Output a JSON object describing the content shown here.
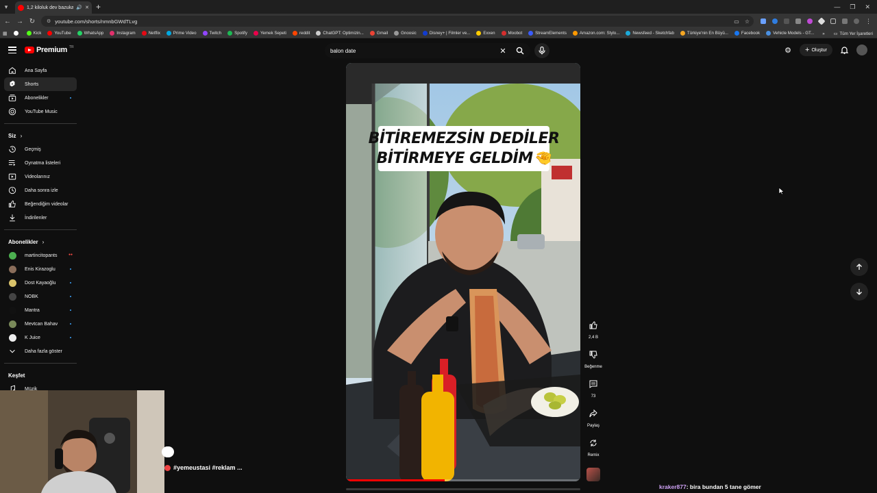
{
  "browser": {
    "tab_title": "1,2 kiloluk dev bazuka 🤡 #",
    "url": "youtube.com/shorts/nmnbGWdTLvg",
    "bookmarks": [
      {
        "label": "",
        "color": "#ffffff"
      },
      {
        "label": "Kick",
        "color": "#53fc18"
      },
      {
        "label": "YouTube",
        "color": "#ff0000"
      },
      {
        "label": "WhatsApp",
        "color": "#25d366"
      },
      {
        "label": "Instagram",
        "color": "#e1306c"
      },
      {
        "label": "Netflix",
        "color": "#e50914"
      },
      {
        "label": "Prime Video",
        "color": "#00a8e1"
      },
      {
        "label": "Twitch",
        "color": "#9146ff"
      },
      {
        "label": "Spotify",
        "color": "#1db954"
      },
      {
        "label": "Yemek Sepeti",
        "color": "#ea004b"
      },
      {
        "label": "reddit",
        "color": "#ff4500"
      },
      {
        "label": "ChatGPT: Optimizin...",
        "color": "#cccccc"
      },
      {
        "label": "Gmail",
        "color": "#ea4335"
      },
      {
        "label": "Gnoosic",
        "color": "#999999"
      },
      {
        "label": "Disney+ | Filmler ve...",
        "color": "#113ccf"
      },
      {
        "label": "Exxen",
        "color": "#ffcc00"
      },
      {
        "label": "Moobot",
        "color": "#d62e2e"
      },
      {
        "label": "StreamElements",
        "color": "#3a5cff"
      },
      {
        "label": "Amazon.com: Stylo...",
        "color": "#ff9900"
      },
      {
        "label": "Newsfeed - Sketchfab",
        "color": "#1caad9"
      },
      {
        "label": "Türkiye'nin En Büyü...",
        "color": "#f5a623"
      },
      {
        "label": "Facebook",
        "color": "#1877f2"
      },
      {
        "label": "Vehicle Models - GT...",
        "color": "#4a90e2"
      }
    ],
    "bookmarks_more": "»",
    "all_bookmarks": "Tüm Yer İşaretleri"
  },
  "header": {
    "logo_text": "Premium",
    "logo_region": "TR",
    "search_value": "balon date",
    "create_label": "Oluştur"
  },
  "sidebar": {
    "main": [
      {
        "label": "Ana Sayfa",
        "icon": "home-icon",
        "active": false
      },
      {
        "label": "Shorts",
        "icon": "shorts-icon",
        "active": true
      },
      {
        "label": "Abonelikler",
        "icon": "subscriptions-icon",
        "active": false,
        "dot": true
      },
      {
        "label": "YouTube Music",
        "icon": "music-icon",
        "active": false
      }
    ],
    "you_heading": "Siz",
    "you": [
      {
        "label": "Geçmiş",
        "icon": "history-icon"
      },
      {
        "label": "Oynatma listeleri",
        "icon": "playlists-icon"
      },
      {
        "label": "Videolarınız",
        "icon": "your-videos-icon"
      },
      {
        "label": "Daha sonra izle",
        "icon": "watch-later-icon"
      },
      {
        "label": "Beğendiğim videolar",
        "icon": "liked-icon"
      },
      {
        "label": "İndirilenler",
        "icon": "downloads-icon"
      }
    ],
    "subs_heading": "Abonelikler",
    "subs": [
      {
        "label": "martincitopants",
        "color": "#4caf50",
        "live": true
      },
      {
        "label": "Enis Kirazoglu",
        "color": "#8a6d5a",
        "dot": true
      },
      {
        "label": "Dost Kayaoğlu",
        "color": "#d9c26a",
        "dot": true
      },
      {
        "label": "NOBK",
        "color": "#444444",
        "dot": true
      },
      {
        "label": "Mantra",
        "color": "#111111",
        "dot": true
      },
      {
        "label": "Mevtcan Bahav",
        "color": "#7a8a5a",
        "dot": true
      },
      {
        "label": "K Juice",
        "color": "#eeeeee",
        "dot": true
      }
    ],
    "show_more": "Daha fazla göster",
    "explore_heading": "Keşfet",
    "explore": [
      {
        "label": "Müzik",
        "icon": "music-note-icon"
      }
    ]
  },
  "short": {
    "caption_line1": "BİTİREMEZSİN DEDİLER",
    "caption_line2": "BİTİRMEYE GELDİM🤏",
    "progress": 0.42,
    "tags": "#yemeustasi #reklam ..."
  },
  "actions": {
    "like_count": "2,4 B",
    "dislike_label": "Beğenme",
    "comment_count": "73",
    "share_label": "Paylaş",
    "remix_label": "Remix"
  },
  "chat": {
    "user": "kraker877",
    "message": ": bira bundan 5 tane gömer"
  },
  "colors": {
    "background": "#0f0f0f",
    "accent": "#ff0000",
    "link_blue": "#3ea6ff"
  }
}
